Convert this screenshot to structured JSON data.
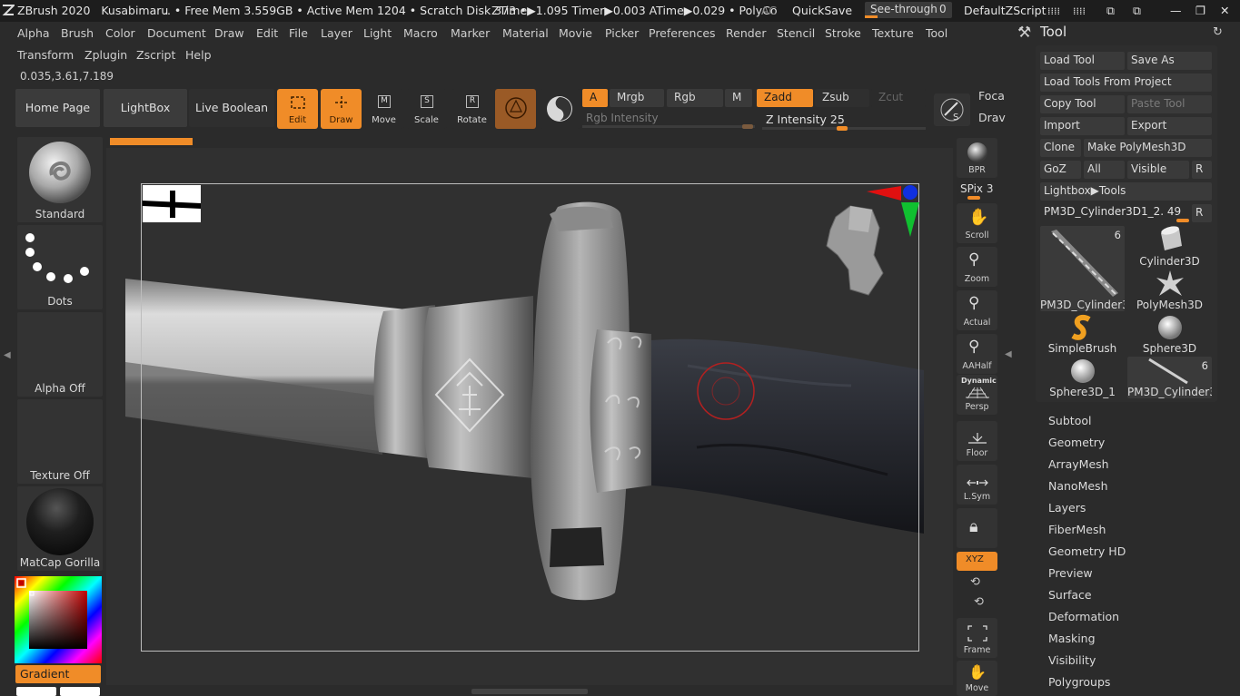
{
  "titlebar": {
    "app": "ZBrush 2020",
    "doc": "Kusabimaru",
    "mem": ".. • Free Mem 3.559GB • Active Mem 1204 • Scratch Disk 373 •",
    "timers": "ZTime▶1.095 Timer▶0.003 ATime▶0.029 • PolyCo",
    "ac": "AC",
    "quicksave": "QuickSave",
    "seethrough_label": "See-through",
    "seethrough_value": "0",
    "script": "DefaultZScript"
  },
  "menu_row1": [
    "Alpha",
    "Brush",
    "Color",
    "Document",
    "Draw",
    "Edit",
    "File",
    "Layer",
    "Light",
    "Macro",
    "Marker",
    "Material",
    "Movie",
    "Picker",
    "Preferences",
    "Render",
    "Stencil",
    "Stroke",
    "Texture",
    "Tool"
  ],
  "menu_row2": [
    "Transform",
    "Zplugin",
    "Zscript",
    "Help"
  ],
  "coords": "0.035,3.61,7.189",
  "shelf": {
    "home": "Home Page",
    "lightbox": "LightBox",
    "live_boolean": "Live Boolean",
    "edit": "Edit",
    "draw": "Draw",
    "move": "Move",
    "scale": "Scale",
    "rotate": "Rotate",
    "a": "A",
    "mrgb": "Mrgb",
    "rgb": "Rgb",
    "m": "M",
    "zadd": "Zadd",
    "zsub": "Zsub",
    "zcut": "Zcut",
    "rgb_intensity": "Rgb Intensity",
    "z_intensity": "Z Intensity 25",
    "focal": "Foca",
    "draw2": "Drav"
  },
  "left_panel": {
    "brush": "Standard",
    "stroke": "Dots",
    "alpha": "Alpha Off",
    "texture": "Texture Off",
    "material": "MatCap Gorilla",
    "gradient": "Gradient"
  },
  "right_toolbar": {
    "bpr": "BPR",
    "spix": "SPix 3",
    "scroll": "Scroll",
    "zoom": "Zoom",
    "actual": "Actual",
    "aahalf": "AAHalf",
    "dynamic": "Dynamic",
    "persp": "Persp",
    "floor": "Floor",
    "lsym": "L.Sym",
    "xyz": "XYZ",
    "frame": "Frame",
    "move": "Move"
  },
  "tool_palette": {
    "title": "Tool",
    "load_tool": "Load Tool",
    "save_as": "Save As",
    "load_from_project": "Load Tools From Project",
    "copy_tool": "Copy Tool",
    "paste_tool": "Paste Tool",
    "import": "Import",
    "export": "Export",
    "clone": "Clone",
    "make_polymesh": "Make PolyMesh3D",
    "goz": "GoZ",
    "all": "All",
    "visible": "Visible",
    "r": "R",
    "lightbox_tools": "Lightbox▶Tools",
    "current_tool": "PM3D_Cylinder3D1_2. 49",
    "thumbs": [
      {
        "name": "PM3D_Cylinder3",
        "count": "6"
      },
      {
        "name": "Cylinder3D",
        "count": ""
      },
      {
        "name": "PolyMesh3D",
        "count": ""
      },
      {
        "name": "SimpleBrush",
        "count": ""
      },
      {
        "name": "Sphere3D",
        "count": ""
      },
      {
        "name": "Sphere3D_1",
        "count": ""
      },
      {
        "name": "PM3D_Cylinder3",
        "count": "6"
      }
    ],
    "sections": [
      "Subtool",
      "Geometry",
      "ArrayMesh",
      "NanoMesh",
      "Layers",
      "FiberMesh",
      "Geometry HD",
      "Preview",
      "Surface",
      "Deformation",
      "Masking",
      "Visibility",
      "Polygroups"
    ]
  },
  "colors": {
    "accent": "#f08c28",
    "bg": "#2b2b2b"
  }
}
